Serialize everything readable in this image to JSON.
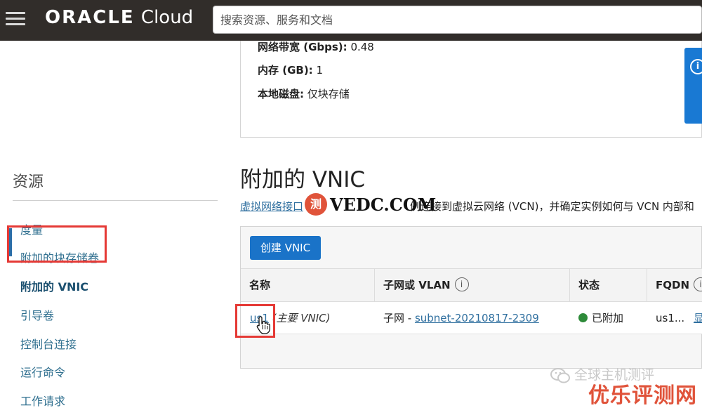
{
  "topbar": {
    "logo_brand": "ORACLE",
    "logo_product": "Cloud",
    "search_placeholder": "搜索资源、服务和文档"
  },
  "instance_info": {
    "rows": [
      {
        "key": "网络带宽 (Gbps):",
        "value": "0.48"
      },
      {
        "key": "内存 (GB):",
        "value": "1"
      },
      {
        "key": "本地磁盘:",
        "value": "仅块存储"
      }
    ]
  },
  "sidebar": {
    "title": "资源",
    "items": [
      {
        "label": "度量"
      },
      {
        "label": "附加的块存储卷"
      },
      {
        "label": "附加的 VNIC"
      },
      {
        "label": "引导卷"
      },
      {
        "label": "控制台连接"
      },
      {
        "label": "运行命令"
      },
      {
        "label": "工作请求"
      }
    ]
  },
  "section": {
    "title": "附加的 VNIC",
    "desc_link": "虚拟网络接口",
    "desc_rest": "例连接到虚拟云网络 (VCN)，并确定实例如何与 VCN 内部和"
  },
  "table": {
    "create_button": "创建 VNIC",
    "headers": [
      "名称",
      "子网或 VLAN",
      "状态",
      "FQDN"
    ],
    "rows": [
      {
        "name": "us1",
        "name_note": "(主要 VNIC)",
        "subnet_prefix": "子网 - ",
        "subnet_link": "subnet-20210817-2309",
        "status": "已附加",
        "fqdn": "us1...",
        "fqdn_link": "显"
      }
    ]
  },
  "watermarks": {
    "badge": "测",
    "site": "VEDC.COM",
    "wechat": "全球主机测评",
    "brand": "优乐评测网"
  },
  "colors": {
    "topbar": "#312d2a",
    "primary_button": "#1a73c8",
    "link": "#2f6f9f",
    "status_ok": "#2e8b3a",
    "highlight_box": "#e53935"
  }
}
